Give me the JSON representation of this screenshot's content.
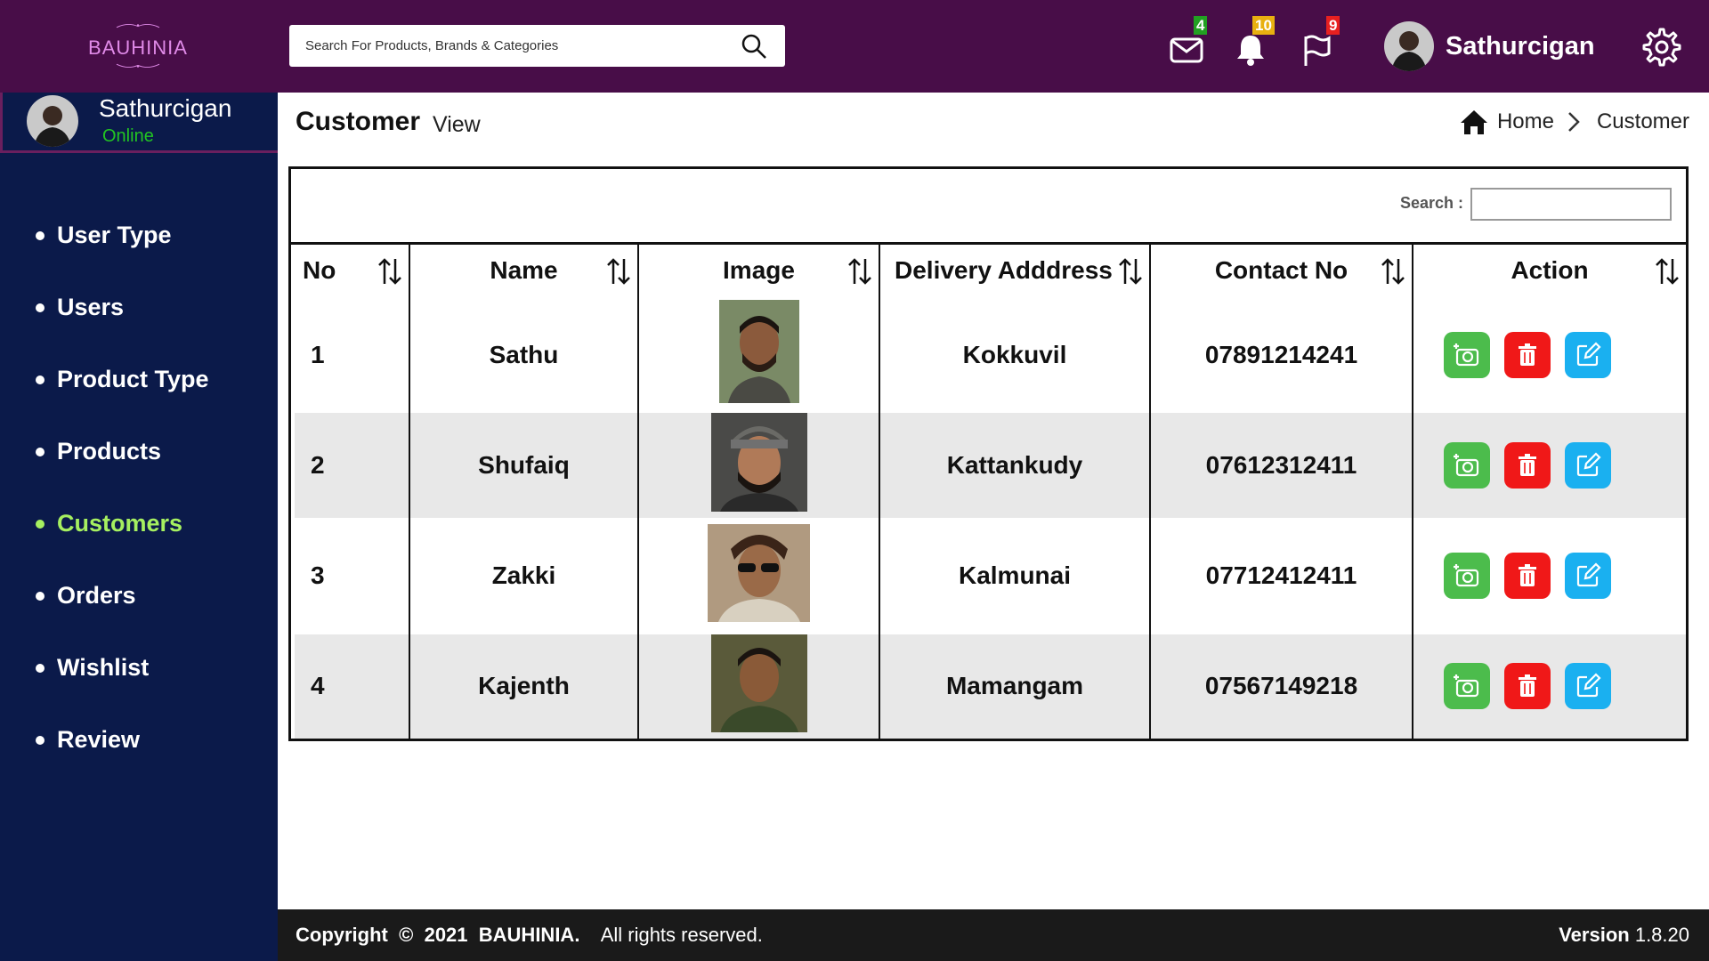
{
  "brand": {
    "name": "BAUHINIA"
  },
  "search": {
    "placeholder": "Search For Products, Brands & Categories"
  },
  "notifications": {
    "mail_count": "4",
    "bell_count": "10",
    "flag_count": "9"
  },
  "user": {
    "name": "Sathurcigan",
    "status": "Online"
  },
  "sidebar": {
    "items": [
      {
        "label": "User Type"
      },
      {
        "label": "Users"
      },
      {
        "label": "Product Type"
      },
      {
        "label": "Products"
      },
      {
        "label": "Customers"
      },
      {
        "label": "Orders"
      },
      {
        "label": "Wishlist"
      },
      {
        "label": "Review"
      }
    ],
    "active": "Customers"
  },
  "page": {
    "title": "Customer",
    "subtitle": "View"
  },
  "breadcrumb": {
    "home": "Home",
    "current": "Customer"
  },
  "table": {
    "search_label": "Search :",
    "columns": [
      "No",
      "Name",
      "Image",
      "Delivery Adddress",
      "Contact No",
      "Action"
    ],
    "rows": [
      {
        "no": "1",
        "name": "Sathu",
        "address": "Kokkuvil",
        "contact": "07891214241"
      },
      {
        "no": "2",
        "name": "Shufaiq",
        "address": "Kattankudy",
        "contact": "07612312411"
      },
      {
        "no": "3",
        "name": "Zakki",
        "address": "Kalmunai",
        "contact": "07712412411"
      },
      {
        "no": "4",
        "name": "Kajenth",
        "address": "Mamangam",
        "contact": "07567149218"
      }
    ]
  },
  "footer": {
    "copyright": "Copyright",
    "symbol": "©",
    "year": "2021",
    "brand": "BAUHINIA.",
    "rights": "All rights reserved.",
    "version_label": "Version",
    "version_value": "1.8.20"
  },
  "colors": {
    "topbar": "#480d48",
    "sidebar": "#0b1a4a",
    "active_menu": "#a6f060",
    "action_add": "#4cbc4c",
    "action_delete": "#f01818",
    "action_edit": "#1ab0f0"
  }
}
